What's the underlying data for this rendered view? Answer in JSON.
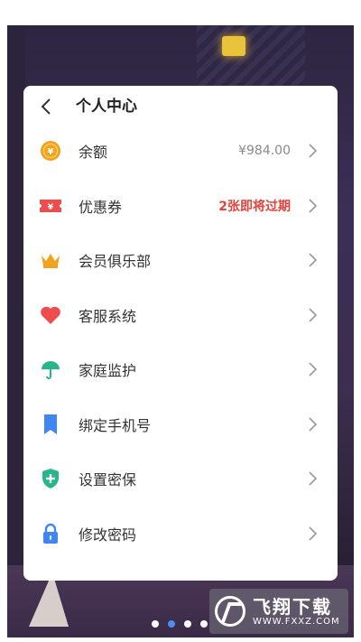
{
  "panel": {
    "title": "个人中心",
    "items": [
      {
        "label": "余额",
        "value": "¥984.00",
        "icon": "coin-icon"
      },
      {
        "label": "优惠券",
        "value": "2张即将过期",
        "icon": "ticket-icon"
      },
      {
        "label": "会员俱乐部",
        "value": "",
        "icon": "crown-icon"
      },
      {
        "label": "客服系统",
        "value": "",
        "icon": "heart-icon"
      },
      {
        "label": "家庭监护",
        "value": "",
        "icon": "umbrella-icon"
      },
      {
        "label": "绑定手机号",
        "value": "",
        "icon": "phone-bookmark-icon"
      },
      {
        "label": "设置密保",
        "value": "",
        "icon": "shield-plus-icon"
      },
      {
        "label": "修改密码",
        "value": "",
        "icon": "lock-icon"
      }
    ]
  },
  "pager": {
    "count": 4,
    "active_index": 1
  },
  "watermark": {
    "title": "飞翔下载",
    "url": "WWW.FXXZ.COM"
  },
  "colors": {
    "coin": "#f2a31b",
    "ticket": "#ee4d4d",
    "crown": "#f2a31b",
    "heart": "#ee4d4d",
    "umbrella": "#27b58a",
    "phone": "#3f86f2",
    "shield": "#27b58a",
    "lock": "#3f86f2",
    "warning_text": "#e5403a"
  }
}
